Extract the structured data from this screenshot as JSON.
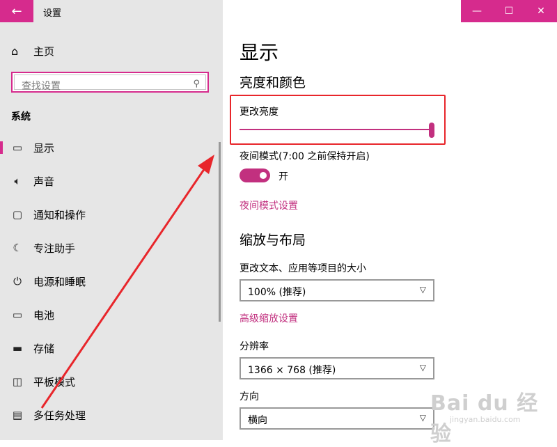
{
  "window": {
    "title": "设置"
  },
  "sidebar": {
    "home": "主页",
    "search_placeholder": "查找设置",
    "section": "系统",
    "items": [
      {
        "icon": "monitor-icon",
        "label": "显示",
        "active": true
      },
      {
        "icon": "speaker-icon",
        "label": "声音"
      },
      {
        "icon": "notification-icon",
        "label": "通知和操作"
      },
      {
        "icon": "moon-icon",
        "label": "专注助手"
      },
      {
        "icon": "power-icon",
        "label": "电源和睡眠"
      },
      {
        "icon": "battery-icon",
        "label": "电池"
      },
      {
        "icon": "storage-icon",
        "label": "存储"
      },
      {
        "icon": "tablet-icon",
        "label": "平板模式"
      },
      {
        "icon": "multitask-icon",
        "label": "多任务处理"
      }
    ]
  },
  "main": {
    "title": "显示",
    "brightness_section": "亮度和颜色",
    "brightness_label": "更改亮度",
    "brightness_value": 1.0,
    "night_mode_label": "夜间模式(7:00 之前保持开启)",
    "night_mode_state": "开",
    "night_mode_link": "夜间模式设置",
    "scale_section": "缩放与布局",
    "scale_label": "更改文本、应用等项目的大小",
    "scale_value": "100% (推荐)",
    "advanced_scale_link": "高级缩放设置",
    "resolution_label": "分辨率",
    "resolution_value": "1366 × 768 (推荐)",
    "orientation_label": "方向",
    "orientation_value": "横向"
  },
  "watermark": {
    "main": "Bai du 经验",
    "sub": "jingyan.baidu.com"
  },
  "colors": {
    "accent": "#d62b8d",
    "link": "#c2307f",
    "highlight": "#e8262b"
  }
}
